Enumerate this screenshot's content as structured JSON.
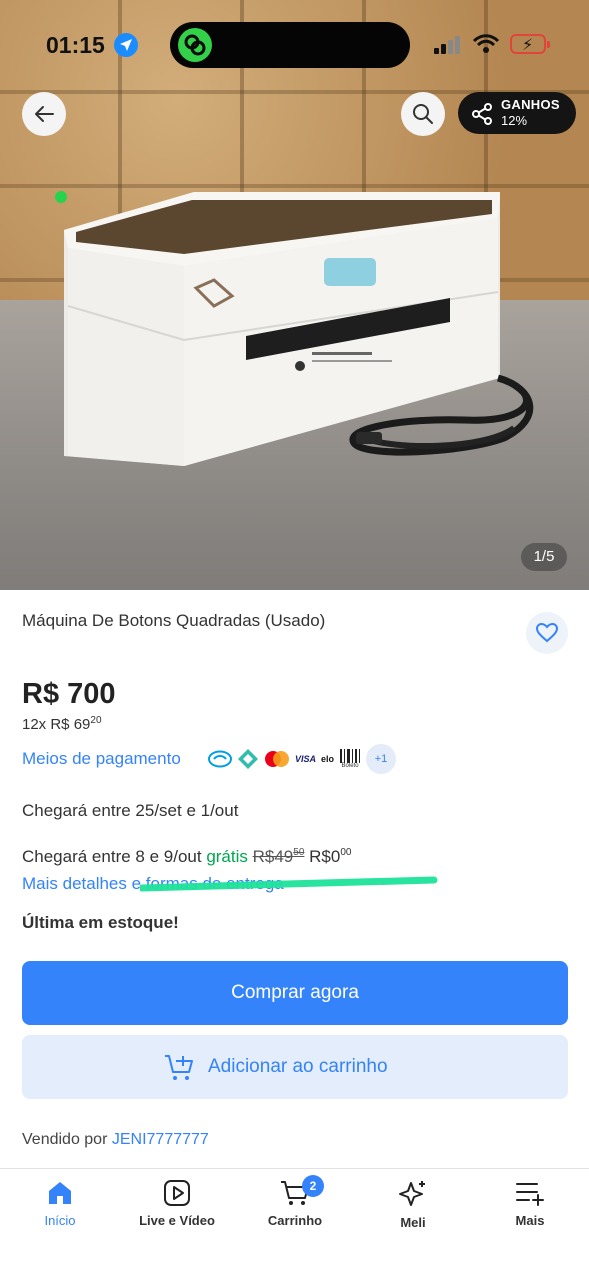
{
  "status_bar": {
    "time": "01:15"
  },
  "header": {
    "earnings_label": "GANHOS",
    "earnings_value": "12%"
  },
  "gallery": {
    "counter": "1/5"
  },
  "product": {
    "title": "Máquina De Botons Quadradas (Usado)",
    "price": "R$ 700",
    "installments_prefix": "12x R$ 69",
    "installments_cents": "20"
  },
  "payment": {
    "link_label": "Meios de pagamento",
    "methods": [
      "mercado-pago-icon",
      "pix-icon",
      "mastercard-icon",
      "VISA",
      "elo",
      "Boleto"
    ],
    "more": "+1"
  },
  "shipping": {
    "option1": "Chegará entre 25/set e 1/out",
    "option2_prefix": "Chegará entre 8 e 9/out",
    "option2_free": "grátis",
    "old_price": "R$49",
    "old_price_cents": "50",
    "new_price": "R$0",
    "new_price_cents": "00",
    "details_link": "Mais detalhes e formas de entrega"
  },
  "stock_label": "Última em estoque!",
  "actions": {
    "buy_now": "Comprar agora",
    "add_to_cart": "Adicionar ao carrinho"
  },
  "seller": {
    "prefix": "Vendido por",
    "name": "JENI7777777"
  },
  "bottom_nav": {
    "items": [
      {
        "label": "Início",
        "icon": "home-icon",
        "active": true
      },
      {
        "label": "Live e Vídeo",
        "icon": "play-icon",
        "active": false
      },
      {
        "label": "Carrinho",
        "icon": "cart-icon",
        "active": false,
        "badge": "2"
      },
      {
        "label": "Meli",
        "icon": "sparkle-icon",
        "active": false
      },
      {
        "label": "Mais",
        "icon": "menu-plus-icon",
        "active": false
      }
    ]
  },
  "colors": {
    "accent": "#3483fa",
    "free_shipping": "#00a650",
    "accent_light": "#e3edfb",
    "text": "#333333"
  }
}
